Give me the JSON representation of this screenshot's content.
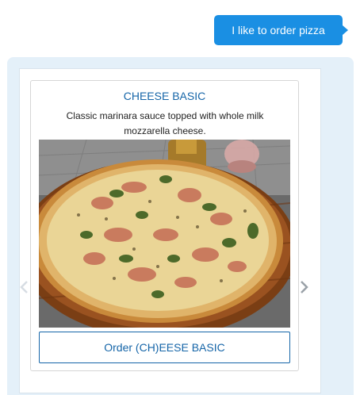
{
  "chat": {
    "user_message": "I like to order pizza"
  },
  "card": {
    "title": "CHEESE BASIC",
    "description": "Classic marinara sauce topped with whole milk mozzarella cheese.",
    "image_icon": "pizza-photo",
    "order_button_label": "Order (CH)EESE BASIC"
  },
  "carousel": {
    "prev_icon": "chevron-left-icon",
    "next_icon": "chevron-right-icon"
  },
  "colors": {
    "user_bubble": "#1a8fe3",
    "bot_panel": "#e4f0f9",
    "accent": "#1565a8"
  }
}
